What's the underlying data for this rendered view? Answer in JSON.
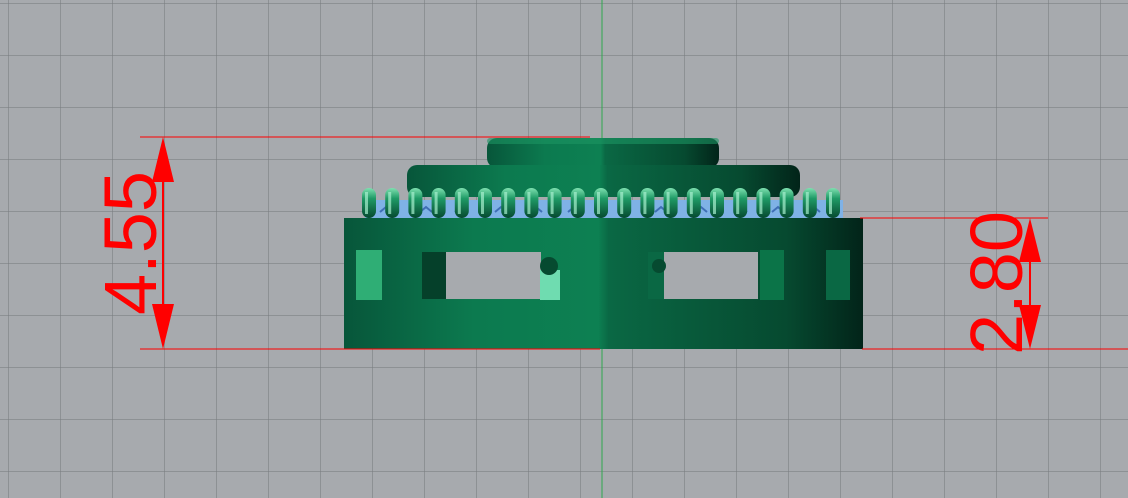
{
  "dimensions": {
    "overall_height": "4.55",
    "lower_height": "2.80"
  },
  "colors": {
    "viewport_bg": "#a7aaae",
    "grid": "#7c8084",
    "dimension": "#ff0000",
    "axis": "#2fa84f",
    "model_dark": "#064a2f",
    "model_mid": "#0b7448",
    "model_light": "#2fae75",
    "inner_blue": "#7fb2e6"
  }
}
